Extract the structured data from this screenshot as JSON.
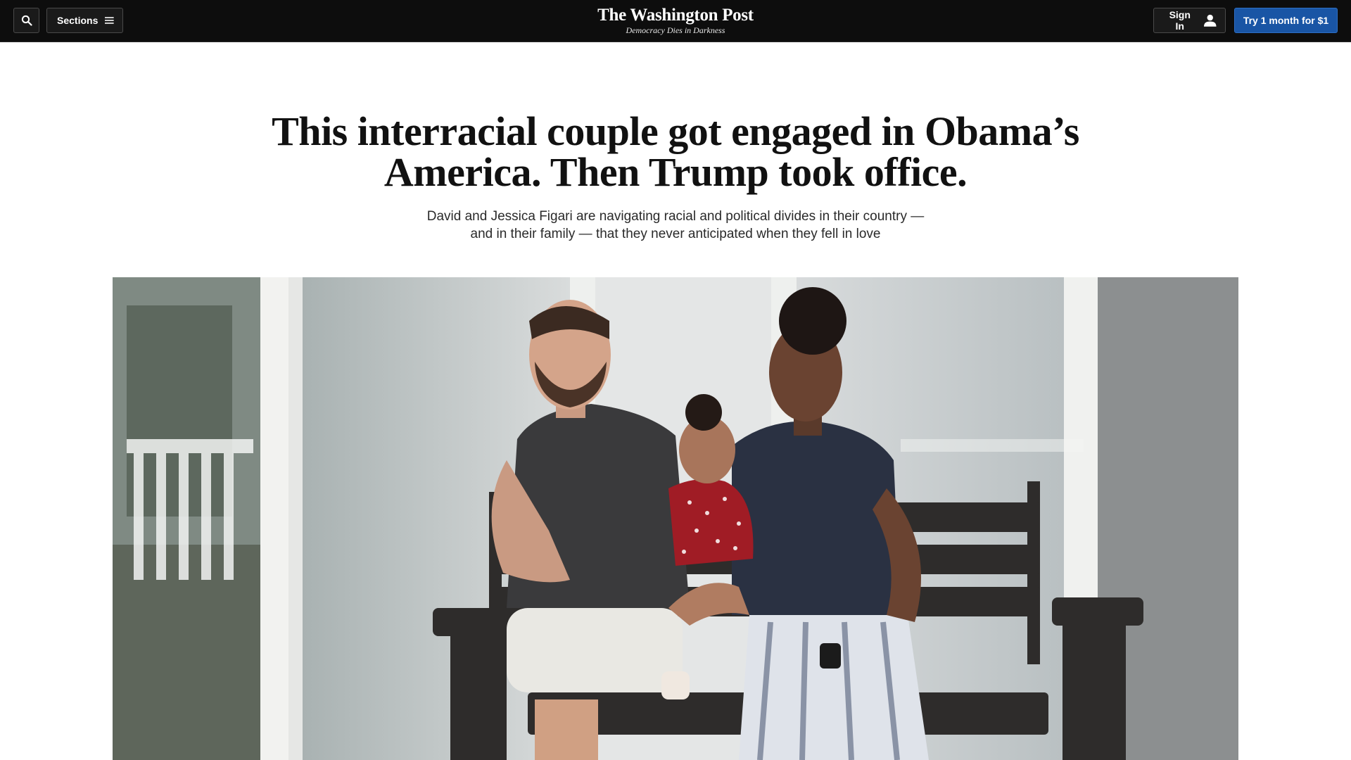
{
  "header": {
    "search_icon": "search-icon",
    "sections_label": "Sections",
    "sections_icon": "hamburger-menu-icon",
    "logo_text": "The Washington Post",
    "tagline": "Democracy Dies in Darkness",
    "signin_label": "Sign In",
    "signin_icon": "user-icon",
    "trial_label": "Try 1 month for $1"
  },
  "article": {
    "headline": "This interracial couple got engaged in Obama’s America. Then Trump took office.",
    "dek": "David and Jessica Figari are navigating racial and political divides in their country — and in their family — that they never anticipated when they fell in love"
  },
  "colors": {
    "nav_background": "#0d0d0d",
    "subscribe_button": "#1955a5",
    "page_background": "#ffffff"
  }
}
